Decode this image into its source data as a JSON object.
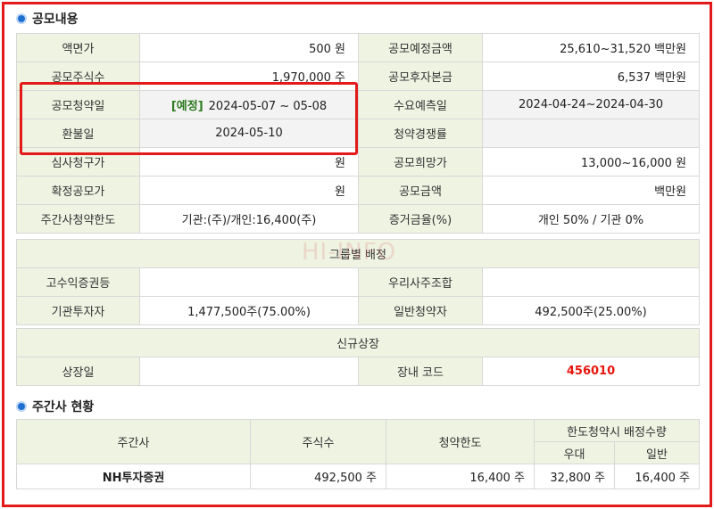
{
  "section1": {
    "title": "공모내용"
  },
  "offering": {
    "face_value_label": "액면가",
    "face_value": "500 원",
    "planned_amount_label": "공모예정금액",
    "planned_amount": "25,610~31,520 백만원",
    "shares_label": "공모주식수",
    "shares": "1,970,000  주",
    "post_capital_label": "공모후자본금",
    "post_capital": "6,537 백만원",
    "subscription_date_label": "공모청약일",
    "subscription_tag": "[예정]",
    "subscription_date": "2024-05-07 ~ 05-08",
    "demand_forecast_label": "수요예측일",
    "demand_forecast": "2024-04-24~2024-04-30",
    "refund_date_label": "환불일",
    "refund_date": "2024-05-10",
    "competition_label": "청약경쟁률",
    "competition": "",
    "review_price_label": "심사청구가",
    "review_price": "원",
    "desired_price_label": "공모희망가",
    "desired_price": "13,000~16,000 원",
    "final_price_label": "확정공모가",
    "final_price": "원",
    "amount_label": "공모금액",
    "amount": "백만원",
    "limit_label": "주간사청약한도",
    "limit": "기관:(주)/개인:16,400(주)",
    "margin_label": "증거금율(%)",
    "margin": "개인 50% / 기관 0%"
  },
  "group": {
    "title": "그룹별 배정",
    "high_yield_label": "고수익증권등",
    "high_yield": "",
    "employee_label": "우리사주조합",
    "employee": "",
    "institution_label": "기관투자자",
    "institution": "1,477,500주(75.00%)",
    "retail_label": "일반청약자",
    "retail": "492,500주(25.00%)"
  },
  "listing": {
    "title": "신규상장",
    "listing_date_label": "상장일",
    "listing_date": "",
    "code_label": "장내 코드",
    "code": "456010"
  },
  "watermark": "HI-INFO",
  "section2": {
    "title": "주간사 현황"
  },
  "underwriters": {
    "headers": {
      "name": "주간사",
      "shares": "주식수",
      "limit": "청약한도",
      "allocation": "한도청약시 배정수량",
      "preferred": "우대",
      "general": "일반"
    },
    "rows": [
      {
        "name": "NH투자증권",
        "shares": "492,500 주",
        "limit": "16,400 주",
        "preferred": "32,800 주",
        "general": "16,400 주"
      }
    ]
  },
  "colors": {
    "label_bg": "#eef3e2",
    "highlight": "#e21a1a",
    "code": "#e8160f",
    "tag": "#2c7a1f"
  }
}
